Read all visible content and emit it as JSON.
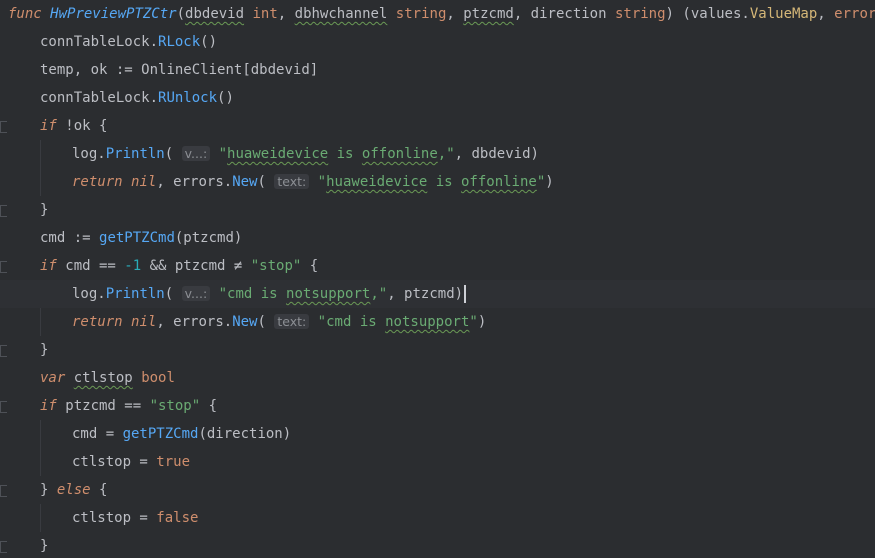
{
  "editor": {
    "lines": [
      {
        "fold": false,
        "tokens": [
          {
            "t": "func",
            "c": "kw"
          },
          {
            "t": " "
          },
          {
            "t": "HwPreviewPTZCtr",
            "c": "fn-def"
          },
          {
            "t": "("
          },
          {
            "t": "dbdevid",
            "c": "param typo"
          },
          {
            "t": " "
          },
          {
            "t": "int",
            "c": "kwn"
          },
          {
            "t": ", "
          },
          {
            "t": "dbhwchannel",
            "c": "param typo"
          },
          {
            "t": " "
          },
          {
            "t": "string",
            "c": "kwn"
          },
          {
            "t": ", "
          },
          {
            "t": "ptzcmd",
            "c": "param typo"
          },
          {
            "t": ", "
          },
          {
            "t": "direction",
            "c": "param"
          },
          {
            "t": " "
          },
          {
            "t": "string",
            "c": "kwn"
          },
          {
            "t": ") ("
          },
          {
            "t": "values",
            "c": "pkg"
          },
          {
            "t": "."
          },
          {
            "t": "ValueMap",
            "c": "typename"
          },
          {
            "t": ", "
          },
          {
            "t": "error",
            "c": "kwn"
          },
          {
            "t": ") {"
          }
        ]
      },
      {
        "indent": 1,
        "tokens": [
          {
            "t": "connTableLock",
            "c": "var"
          },
          {
            "t": "."
          },
          {
            "t": "RLock",
            "c": "call"
          },
          {
            "t": "()"
          }
        ]
      },
      {
        "indent": 1,
        "tokens": [
          {
            "t": "temp, ok := "
          },
          {
            "t": "OnlineClient",
            "c": "var"
          },
          {
            "t": "[dbdevid]"
          }
        ]
      },
      {
        "indent": 1,
        "tokens": [
          {
            "t": "connTableLock",
            "c": "var"
          },
          {
            "t": "."
          },
          {
            "t": "RUnlock",
            "c": "call"
          },
          {
            "t": "()"
          }
        ]
      },
      {
        "indent": 1,
        "fold": true,
        "tokens": [
          {
            "t": "if",
            "c": "kw"
          },
          {
            "t": " !ok {"
          }
        ]
      },
      {
        "indent": 2,
        "tokens": [
          {
            "t": "log",
            "c": "pkg"
          },
          {
            "t": "."
          },
          {
            "t": "Println",
            "c": "call"
          },
          {
            "t": "( "
          },
          {
            "t": "v...:",
            "c": "hint"
          },
          {
            "t": " "
          },
          {
            "t": "\"",
            "c": "str"
          },
          {
            "t": "huaweidevice",
            "c": "str typo"
          },
          {
            "t": " is ",
            "c": "str"
          },
          {
            "t": "offonline",
            "c": "str typo"
          },
          {
            "t": ",\"",
            "c": "str"
          },
          {
            "t": ", dbdevid)"
          }
        ]
      },
      {
        "indent": 2,
        "tokens": [
          {
            "t": "return",
            "c": "kw"
          },
          {
            "t": " "
          },
          {
            "t": "nil",
            "c": "kw"
          },
          {
            "t": ", "
          },
          {
            "t": "errors",
            "c": "pkg"
          },
          {
            "t": "."
          },
          {
            "t": "New",
            "c": "call"
          },
          {
            "t": "( "
          },
          {
            "t": "text:",
            "c": "hint"
          },
          {
            "t": " "
          },
          {
            "t": "\"",
            "c": "str"
          },
          {
            "t": "huaweidevice",
            "c": "str typo"
          },
          {
            "t": " is ",
            "c": "str"
          },
          {
            "t": "offonline",
            "c": "str typo"
          },
          {
            "t": "\"",
            "c": "str"
          },
          {
            "t": ")"
          }
        ]
      },
      {
        "indent": 1,
        "fold": true,
        "tokens": [
          {
            "t": "}"
          }
        ]
      },
      {
        "indent": 1,
        "tokens": [
          {
            "t": "cmd := "
          },
          {
            "t": "getPTZCmd",
            "c": "call"
          },
          {
            "t": "(ptzcmd)"
          }
        ]
      },
      {
        "indent": 1,
        "fold": true,
        "tokens": [
          {
            "t": "if",
            "c": "kw"
          },
          {
            "t": " cmd == "
          },
          {
            "t": "-1",
            "c": "num"
          },
          {
            "t": " && ptzcmd ≠ "
          },
          {
            "t": "\"stop\"",
            "c": "str"
          },
          {
            "t": " {"
          }
        ]
      },
      {
        "indent": 2,
        "current": true,
        "tokens": [
          {
            "t": "log",
            "c": "pkg"
          },
          {
            "t": "."
          },
          {
            "t": "Println",
            "c": "call"
          },
          {
            "t": "( "
          },
          {
            "t": "v...:",
            "c": "hint"
          },
          {
            "t": " "
          },
          {
            "t": "\"cmd is ",
            "c": "str"
          },
          {
            "t": "notsupport",
            "c": "str typo"
          },
          {
            "t": ",\"",
            "c": "str"
          },
          {
            "t": ", ptzcmd)"
          }
        ]
      },
      {
        "indent": 2,
        "tokens": [
          {
            "t": "return",
            "c": "kw"
          },
          {
            "t": " "
          },
          {
            "t": "nil",
            "c": "kw"
          },
          {
            "t": ", "
          },
          {
            "t": "errors",
            "c": "pkg"
          },
          {
            "t": "."
          },
          {
            "t": "New",
            "c": "call"
          },
          {
            "t": "( "
          },
          {
            "t": "text:",
            "c": "hint"
          },
          {
            "t": " "
          },
          {
            "t": "\"cmd is ",
            "c": "str"
          },
          {
            "t": "notsupport",
            "c": "str typo"
          },
          {
            "t": "\"",
            "c": "str"
          },
          {
            "t": ")"
          }
        ]
      },
      {
        "indent": 1,
        "fold": true,
        "tokens": [
          {
            "t": "}"
          }
        ]
      },
      {
        "indent": 1,
        "tokens": [
          {
            "t": "var",
            "c": "kw"
          },
          {
            "t": " "
          },
          {
            "t": "ctlstop",
            "c": "var typo"
          },
          {
            "t": " "
          },
          {
            "t": "bool",
            "c": "kwn"
          }
        ]
      },
      {
        "indent": 1,
        "fold": true,
        "tokens": [
          {
            "t": "if",
            "c": "kw"
          },
          {
            "t": " ptzcmd == "
          },
          {
            "t": "\"stop\"",
            "c": "str"
          },
          {
            "t": " {"
          }
        ]
      },
      {
        "indent": 2,
        "tokens": [
          {
            "t": "cmd = "
          },
          {
            "t": "getPTZCmd",
            "c": "call"
          },
          {
            "t": "(direction)"
          }
        ]
      },
      {
        "indent": 2,
        "tokens": [
          {
            "t": "ctlstop = "
          },
          {
            "t": "true",
            "c": "kwn"
          }
        ]
      },
      {
        "indent": 1,
        "fold": true,
        "tokens": [
          {
            "t": "} "
          },
          {
            "t": "else",
            "c": "kw"
          },
          {
            "t": " {"
          }
        ]
      },
      {
        "indent": 2,
        "tokens": [
          {
            "t": "ctlstop = "
          },
          {
            "t": "false",
            "c": "kwn"
          }
        ]
      },
      {
        "indent": 1,
        "fold": true,
        "tokens": [
          {
            "t": "}"
          }
        ]
      }
    ]
  }
}
